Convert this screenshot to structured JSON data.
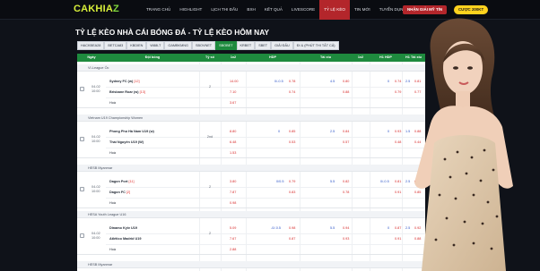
{
  "logo": {
    "main": "CAKHIA",
    "suffix": "Z"
  },
  "nav": [
    "TRANG CHỦ",
    "HIGHLIGHT",
    "LỊCH THI ĐẤU",
    "BXH",
    "KẾT QUẢ",
    "LIVESCORE",
    "TỶ LỆ KÈO",
    "TIN MỚI",
    "TUYỂN DỤNG"
  ],
  "nav_active": 6,
  "buttons": {
    "app": "NHẬN GIẢI MỸ TÍN",
    "bet": "CƯỢC 200KT"
  },
  "page_title": "TỶ LỆ KÈO NHÀ CÁI BÓNG ĐÁ - TỶ LỆ KÈO HÔM NAY",
  "tabs": [
    "HACKBEA28",
    "BETCA83",
    "KBDIEN",
    "W88LT",
    "GAMBKMNG",
    "SBOVNET",
    "SBOBET",
    "KRBET",
    "SBET",
    "GIẢI ĐẤU",
    "ĐI & (PHÚT THI TẤT CẢ)"
  ],
  "tab_active": 6,
  "columns": [
    "Ngày",
    "Đội bóng",
    "Tỷ số",
    "1x2",
    "HDP",
    "Tài xỉu",
    "1x2",
    "H1 HDP",
    "H1 Tài xỉu"
  ],
  "leagues": [
    "VI-League Ốc",
    "Vietnam U19 Championship Women",
    "HESB Myanmar",
    "HESA Youth League U16",
    "HESB Myanmar"
  ],
  "matches": [
    {
      "date": "04-02",
      "time": "10:00",
      "home": "Sydney FC (w)",
      "home_rank": "[12]",
      "away": "Brisbane Roar (w)",
      "away_rank": "[13]",
      "draw": "Hoà",
      "minute": "2",
      "x12": [
        "14.00",
        "7.10",
        "3.67"
      ],
      "hdp": {
        "line": "0/-0.5",
        "v1": "0.78",
        "v2": "0.74"
      },
      "ou": {
        "line": "4.5",
        "v1": "0.80",
        "v2": "0.88"
      },
      "x12b": [
        "",
        "",
        ""
      ],
      "h1": {
        "line": "0",
        "v1": "0.74",
        "v2": "0.79"
      },
      "h1ou": {
        "line": "2.5",
        "v1": "0.81",
        "v2": "0.77"
      }
    },
    {
      "date": "04-02",
      "time": "10:00",
      "home": "Phong Phú Hà Nam U19 (w)",
      "home_rank": "",
      "away": "Thái Nguyên U19 (W)",
      "away_rank": "",
      "draw": "Hoà",
      "minute": "2nd",
      "x12": [
        "8.80",
        "6.48",
        "1.53"
      ],
      "hdp": {
        "line": "0",
        "v1": "0.85",
        "v2": "0.53"
      },
      "ou": {
        "line": "2.5",
        "v1": "0.84",
        "v2": "0.57"
      },
      "x12b": [
        "",
        "",
        ""
      ],
      "h1": {
        "line": "0",
        "v1": "0.93",
        "v2": "0.48"
      },
      "h1ou": {
        "line": "1.5",
        "v1": "0.88",
        "v2": "0.44"
      }
    },
    {
      "date": "04-02",
      "time": "10:00",
      "home": "Dagon Port",
      "home_rank": "[11]",
      "away": "Dagon FC",
      "away_rank": "[2]",
      "draw": "Hoà",
      "minute": "2",
      "x12": [
        "3.80",
        "7.87",
        "0.98"
      ],
      "hdp": {
        "line": "0/0.5",
        "v1": "0.79",
        "v2": "0.83"
      },
      "ou": {
        "line": "5.5",
        "v1": "0.82",
        "v2": "0.78"
      },
      "x12b": [
        "",
        "",
        ""
      ],
      "h1": {
        "line": "0/-0.5",
        "v1": "0.81",
        "v2": "0.91"
      },
      "h1ou": {
        "line": "2.5",
        "v1": "0.79",
        "v2": "0.85"
      }
    },
    {
      "date": "04-02",
      "time": "10:00",
      "home": "Dinamo Kyiv U19",
      "home_rank": "",
      "away": "Atlético Madrid U19",
      "away_rank": "",
      "draw": "Hoà",
      "minute": "2",
      "x12": [
        "5.09",
        "7.67",
        "2.88"
      ],
      "hdp": {
        "line": "-0/-0.5",
        "v1": "0.98",
        "v2": "0.87"
      },
      "ou": {
        "line": "5.5",
        "v1": "0.94",
        "v2": "0.93"
      },
      "x12b": [
        "",
        "",
        ""
      ],
      "h1": {
        "line": "0",
        "v1": "0.87",
        "v2": "0.91"
      },
      "h1ou": {
        "line": "2.5",
        "v1": "0.92",
        "v2": "0.88"
      }
    }
  ]
}
